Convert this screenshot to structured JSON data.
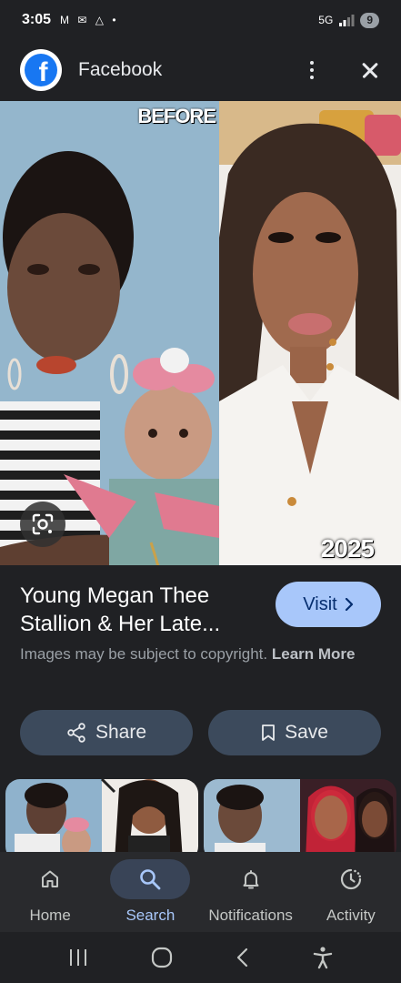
{
  "status_bar": {
    "time": "3:05",
    "left_icons": "M ✉ △ •",
    "network": "5G",
    "battery": "9"
  },
  "header": {
    "app_icon": "facebook-logo",
    "title": "Facebook"
  },
  "hero": {
    "label_before": "BEFORE",
    "label_year": "2025"
  },
  "result": {
    "title": "Young Megan Thee Stallion & Her Late...",
    "visit_label": "Visit",
    "copyright_text": "Images may be subject to copyright.",
    "learn_more": "Learn More"
  },
  "actions": {
    "share_label": "Share",
    "save_label": "Save"
  },
  "bottom_nav": {
    "items": [
      {
        "label": "Home",
        "icon": "home-icon"
      },
      {
        "label": "Search",
        "icon": "search-icon"
      },
      {
        "label": "Notifications",
        "icon": "bell-icon"
      },
      {
        "label": "Activity",
        "icon": "activity-icon"
      }
    ]
  },
  "colors": {
    "background": "#202124",
    "accent": "#a8c7fa",
    "facebook_blue": "#1877f2"
  }
}
